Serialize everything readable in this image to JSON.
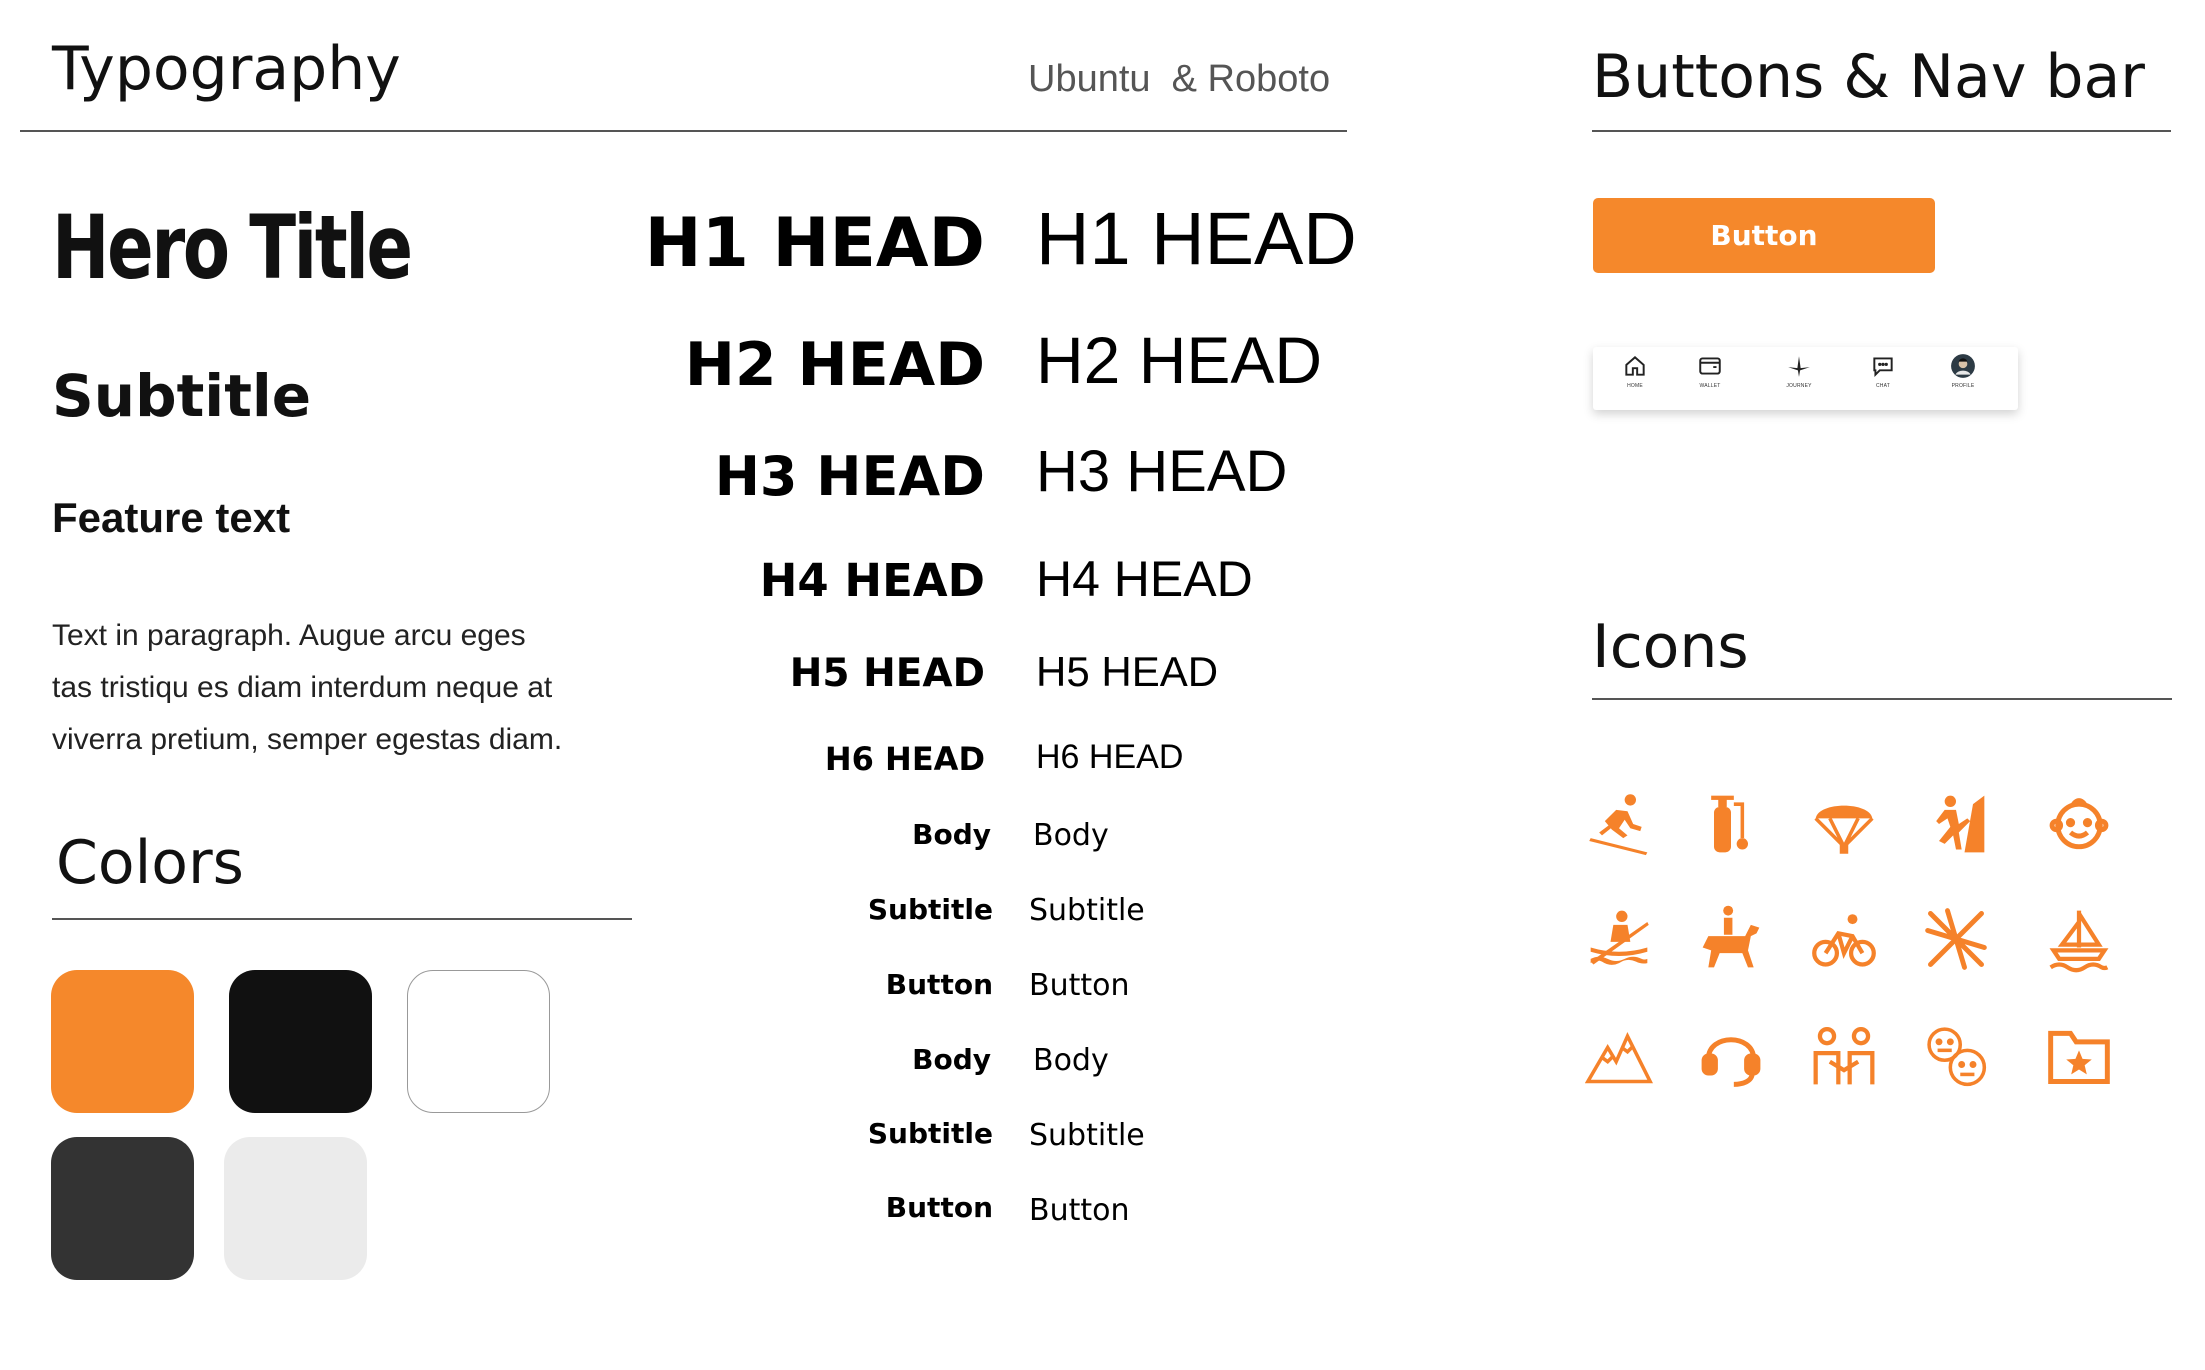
{
  "typography": {
    "title": "Typography",
    "fonts_note": "Ubuntu  & Roboto",
    "hero": "Hero Title",
    "subtitle": "Subtitle",
    "feature": "Feature text",
    "paragraph": [
      "Text in paragraph. Augue arcu eges",
      "tas tristiqu es diam interdum neque at",
      "viverra pretium, semper egestas diam."
    ],
    "scale_bold": [
      "H1 HEAD",
      "H2 HEAD",
      "H3 HEAD",
      "H4 HEAD",
      "H5 HEAD",
      "H6 HEAD",
      "Body",
      "Subtitle",
      "Button",
      "Body",
      "Subtitle",
      "Button"
    ],
    "scale_regular": [
      "H1 HEAD",
      "H2 HEAD",
      "H3 HEAD",
      "H4 HEAD",
      "H5 HEAD",
      "H6 HEAD",
      "Body",
      "Subtitle",
      "Button",
      "Body",
      "Subtitle",
      "Button"
    ]
  },
  "colors": {
    "title": "Colors",
    "swatches": [
      "#F5882B",
      "#111111",
      "#FFFFFF",
      "#333333",
      "#EBEBEB"
    ]
  },
  "buttons": {
    "title": "Buttons & Nav bar",
    "button_label": "Button",
    "nav_items": [
      {
        "label": "HOME",
        "icon": "home-icon"
      },
      {
        "label": "WALLET",
        "icon": "wallet-icon"
      },
      {
        "label": "JOURNEY",
        "icon": "journey-icon"
      },
      {
        "label": "CHAT",
        "icon": "chat-icon"
      },
      {
        "label": "PROFILE",
        "icon": "profile-avatar"
      }
    ]
  },
  "icons": {
    "title": "Icons",
    "accent": "#F5822A",
    "items": [
      "skiing-icon",
      "scuba-tank-icon",
      "parachute-icon",
      "climbing-icon",
      "baby-face-icon",
      "kayaking-icon",
      "horse-riding-icon",
      "cycling-icon",
      "crossed-skis-icon",
      "sailboat-icon",
      "mountains-icon",
      "headset-icon",
      "group-icon",
      "faces-icon",
      "starred-folder-icon"
    ]
  }
}
